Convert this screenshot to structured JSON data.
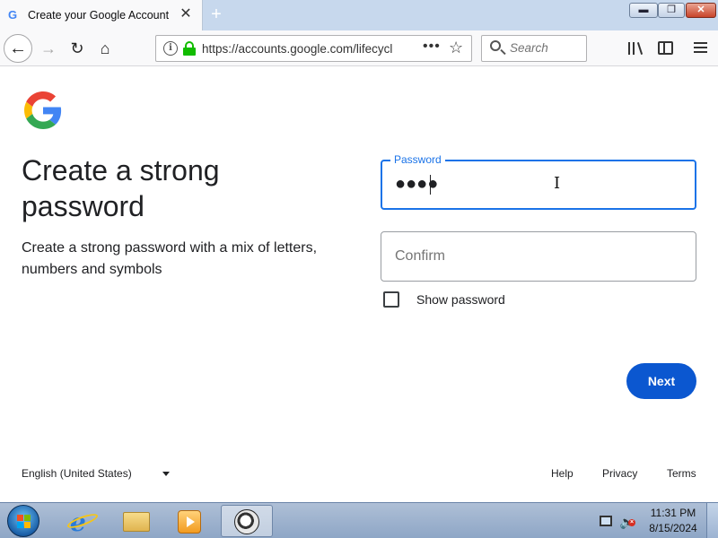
{
  "browser": {
    "tab": {
      "title": "Create your Google Account",
      "favicon": "G",
      "close_symbol": "✕"
    },
    "new_tab_symbol": "+",
    "window_controls": {
      "minimize": "▬",
      "maximize": "❐",
      "close": "✕"
    },
    "nav": {
      "back": "←",
      "forward": "→",
      "reload": "↻",
      "home": "⌂"
    },
    "url": "https://accounts.google.com/lifecycle/steps/signup/password",
    "url_more": "•••",
    "bookmark_star": "☆",
    "search_placeholder": "Search"
  },
  "page": {
    "heading": "Create a strong password",
    "subtext": "Create a strong password with a mix of letters, numbers and symbols",
    "password_field": {
      "label": "Password",
      "value_masked": "●●●●"
    },
    "confirm_field": {
      "placeholder": "Confirm"
    },
    "show_password_label": "Show password",
    "show_password_checked": false,
    "next_button": "Next",
    "footer": {
      "language": "English (United States)",
      "help": "Help",
      "privacy": "Privacy",
      "terms": "Terms"
    }
  },
  "colors": {
    "google_blue": "#4285f4",
    "google_red": "#ea4335",
    "google_yellow": "#fbbc05",
    "google_green": "#34a853",
    "focus_blue": "#1a73e8",
    "button_blue": "#0b57d0"
  },
  "taskbar": {
    "pinned": [
      "internet-explorer-icon",
      "file-explorer-icon",
      "media-player-icon",
      "firefox-icon"
    ],
    "clock_time": "11:31 PM",
    "clock_date": "8/15/2024"
  }
}
